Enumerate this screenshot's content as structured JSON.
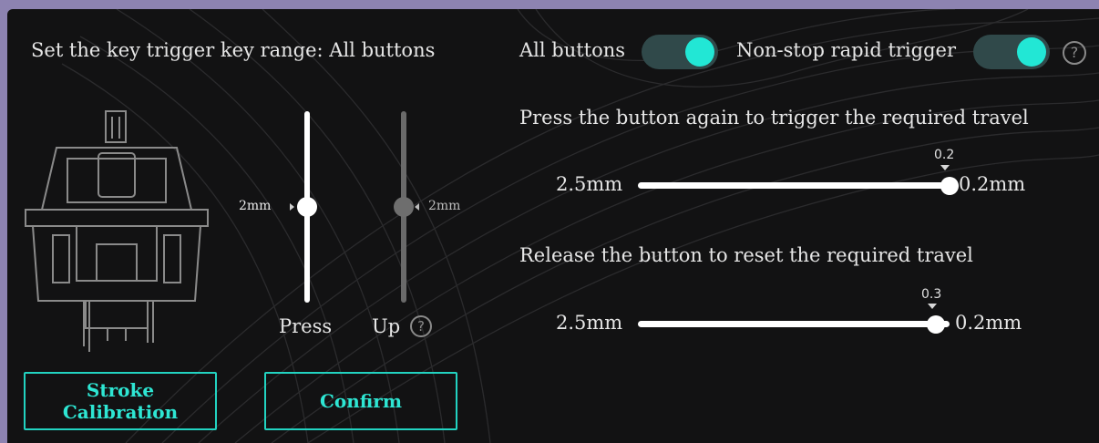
{
  "range": {
    "label": "Set the key trigger key range:  All buttons"
  },
  "toggles": {
    "all_buttons": {
      "label": "All buttons",
      "on": true
    },
    "non_stop": {
      "label": "Non-stop rapid trigger",
      "on": true
    },
    "help": "?"
  },
  "switch_graphic": {
    "icon": "mechanical-switch-icon"
  },
  "press_slider": {
    "label": "Press",
    "value": "2mm"
  },
  "up_slider": {
    "label": "Up",
    "value": "2mm",
    "help": "?"
  },
  "trigger_travel": {
    "title": "Press the button again to trigger the required travel",
    "min_label": "2.5mm",
    "max_label": "0.2mm",
    "value": "0.2",
    "fraction": 1.0
  },
  "reset_travel": {
    "title": "Release the button to reset the required travel",
    "min_label": "2.5mm",
    "max_label": "0.2mm",
    "value": "0.3",
    "fraction": 0.955
  },
  "buttons": {
    "calibration": "Stroke Calibration",
    "confirm": "Confirm"
  },
  "colors": {
    "accent": "#22e7d5",
    "panel_bg": "#121213",
    "frame": "#8d83b1"
  }
}
